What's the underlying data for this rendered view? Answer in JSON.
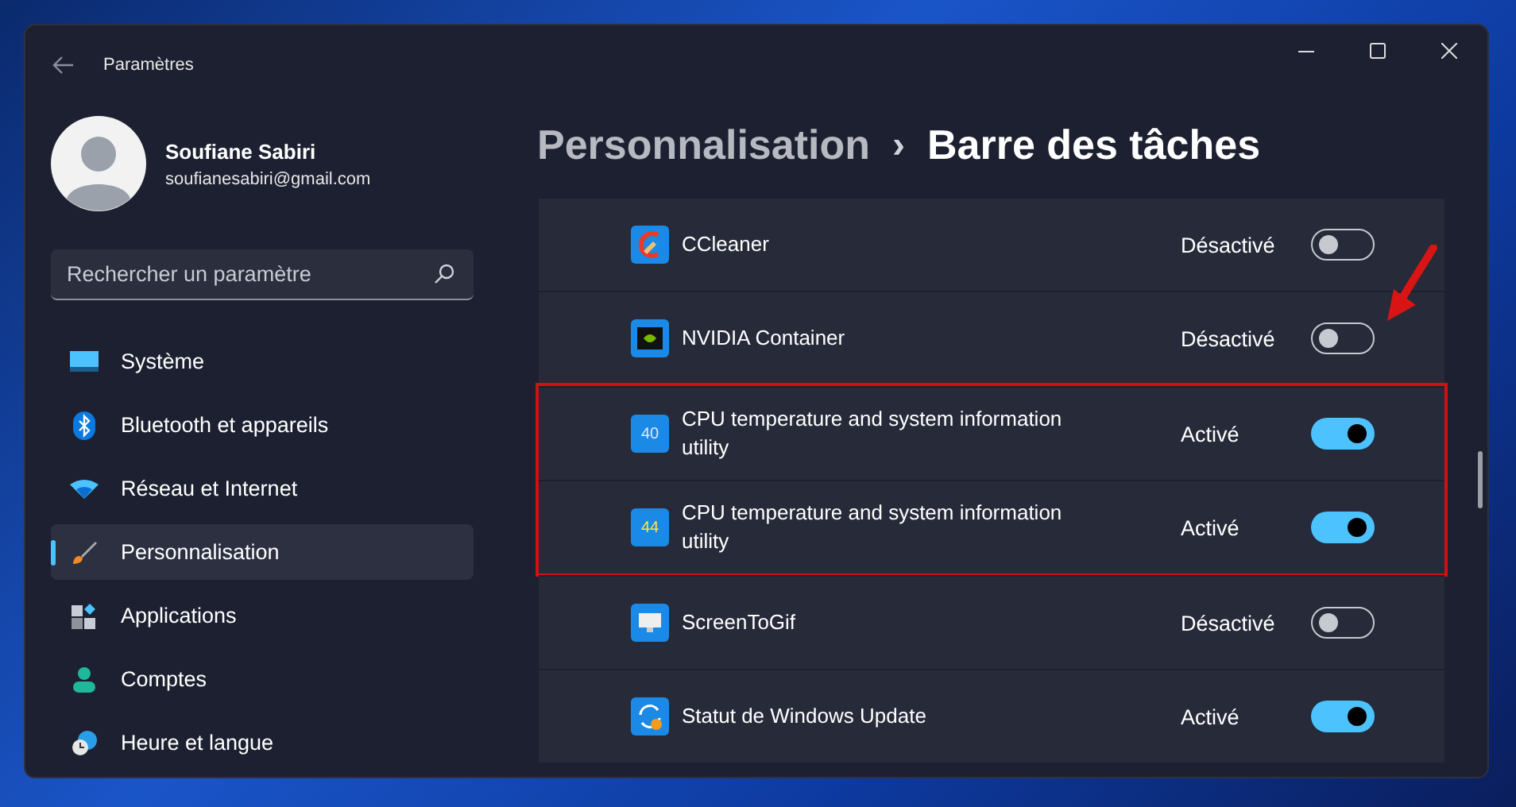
{
  "window": {
    "title": "Paramètres"
  },
  "profile": {
    "name": "Soufiane Sabiri",
    "email": "soufianesabiri@gmail.com"
  },
  "search": {
    "placeholder": "Rechercher un paramètre"
  },
  "sidebar": {
    "items": [
      {
        "label": "Système",
        "kind": "system",
        "selected": false
      },
      {
        "label": "Bluetooth et appareils",
        "kind": "bluetooth",
        "selected": false
      },
      {
        "label": "Réseau et Internet",
        "kind": "wifi",
        "selected": false
      },
      {
        "label": "Personnalisation",
        "kind": "brush",
        "selected": true
      },
      {
        "label": "Applications",
        "kind": "apps",
        "selected": false
      },
      {
        "label": "Comptes",
        "kind": "person",
        "selected": false
      },
      {
        "label": "Heure et langue",
        "kind": "clock",
        "selected": false
      }
    ]
  },
  "breadcrumb": {
    "parent": "Personnalisation",
    "separator": "›",
    "current": "Barre des tâches"
  },
  "apps": [
    {
      "name": "CCleaner",
      "kind": "ccleaner",
      "status": "Désactivé",
      "on": false,
      "highlighted": false
    },
    {
      "name": "NVIDIA Container",
      "kind": "nvidia",
      "status": "Désactivé",
      "on": false,
      "highlighted": false
    },
    {
      "name": "CPU temperature and system information utility",
      "kind": "number",
      "icon_text": "40",
      "status": "Activé",
      "on": true,
      "highlighted": true
    },
    {
      "name": "CPU temperature and system information utility",
      "kind": "number",
      "icon_text": "44",
      "status": "Activé",
      "on": true,
      "highlighted": true
    },
    {
      "name": "ScreenToGif",
      "kind": "screen",
      "status": "Désactivé",
      "on": false,
      "highlighted": false
    },
    {
      "name": "Statut de Windows Update",
      "kind": "update",
      "status": "Activé",
      "on": true,
      "highlighted": false
    }
  ],
  "annotation_arrow": true
}
